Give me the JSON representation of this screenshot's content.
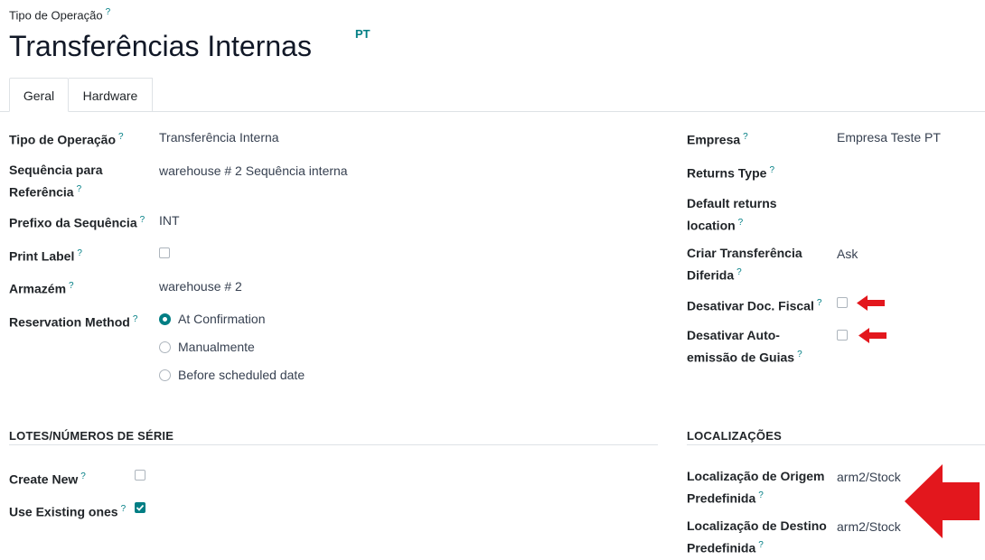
{
  "header": {
    "breadcrumb_label": "Tipo de Operação",
    "help": "?",
    "title": "Transferências Internas",
    "lang_badge": "PT"
  },
  "tabs": [
    {
      "label": "Geral",
      "active": true
    },
    {
      "label": "Hardware",
      "active": false
    }
  ],
  "left_fields": {
    "tipo_operacao": {
      "label": "Tipo de Operação",
      "value": "Transferência Interna"
    },
    "sequencia": {
      "label_line1": "Sequência para",
      "label_line2": "Referência",
      "value": "warehouse # 2 Sequência interna"
    },
    "prefixo": {
      "label": "Prefixo da Sequência",
      "value": "INT"
    },
    "print_label": {
      "label": "Print Label",
      "checked": false
    },
    "armazem": {
      "label": "Armazém",
      "value": "warehouse # 2"
    },
    "reservation": {
      "label": "Reservation Method",
      "options": [
        {
          "label": "At Confirmation",
          "selected": true
        },
        {
          "label": "Manualmente",
          "selected": false
        },
        {
          "label": "Before scheduled date",
          "selected": false
        }
      ]
    }
  },
  "right_fields": {
    "empresa": {
      "label": "Empresa",
      "value": "Empresa Teste PT"
    },
    "returns_type": {
      "label": "Returns Type",
      "value": ""
    },
    "default_returns": {
      "label_line1": "Default returns",
      "label_line2": "location",
      "value": ""
    },
    "criar_transferencia": {
      "label_line1": "Criar Transferência",
      "label_line2": "Diferida",
      "value": "Ask"
    },
    "desativar_doc": {
      "label": "Desativar Doc. Fiscal",
      "checked": false
    },
    "desativar_auto": {
      "label_line1": "Desativar Auto-",
      "label_line2": "emissão de Guias",
      "checked": false
    }
  },
  "lotes_section": {
    "title": "LOTES/NÚMEROS DE SÉRIE",
    "create_new": {
      "label": "Create New",
      "checked": false
    },
    "use_existing": {
      "label": "Use Existing ones",
      "checked": true
    }
  },
  "localizacoes_section": {
    "title": "LOCALIZAÇÕES",
    "origem": {
      "label_line1": "Localização de Origem",
      "label_line2": "Predefinida",
      "value": "arm2/Stock"
    },
    "destino": {
      "label_line1": "Localização de Destino",
      "label_line2": "Predefinida",
      "value": "arm2/Stock"
    }
  },
  "annotation_color": "#e3171d",
  "accent_color": "#017e84"
}
